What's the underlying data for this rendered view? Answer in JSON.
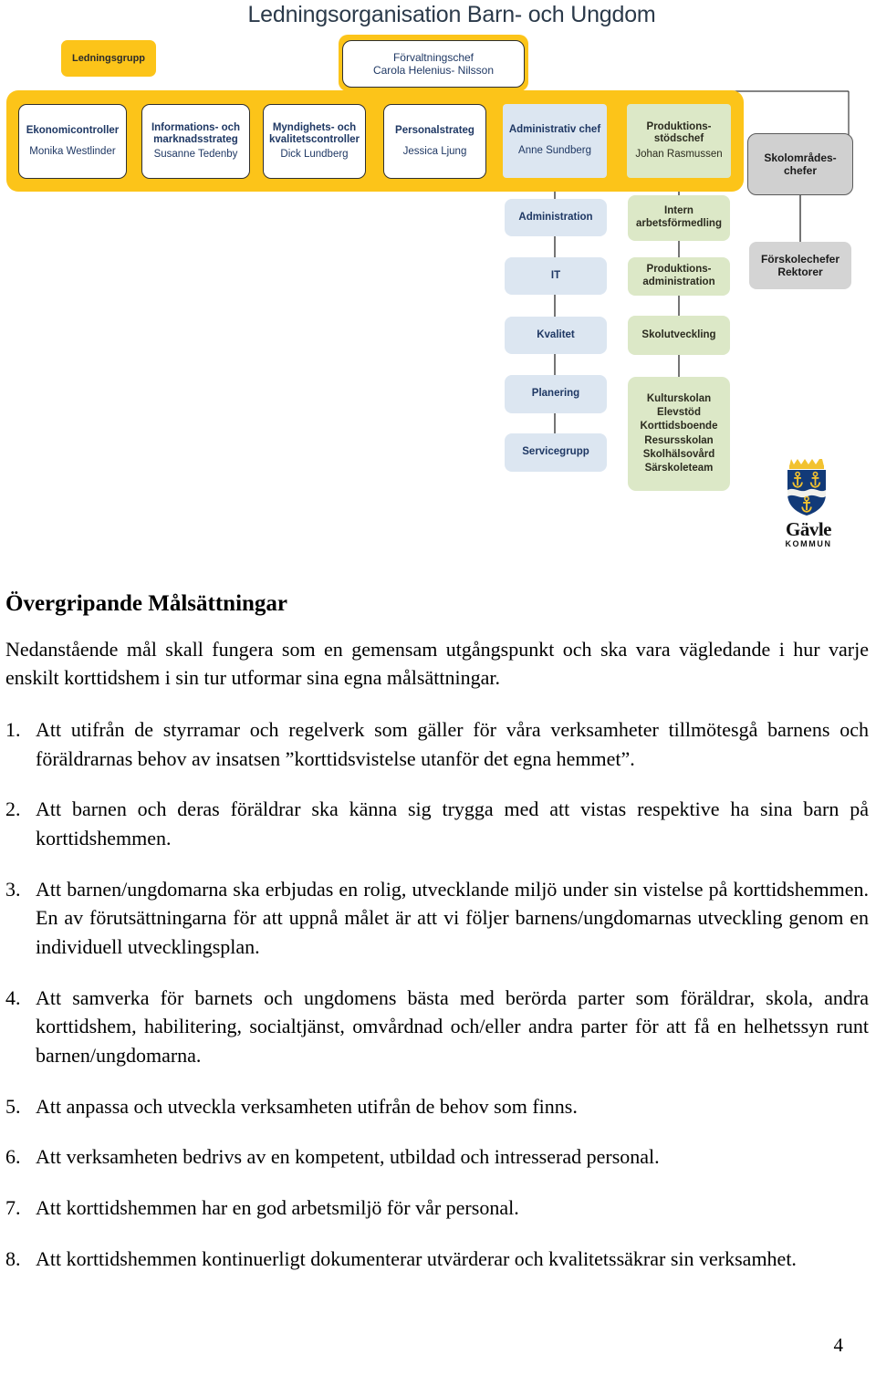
{
  "chart": {
    "title": "Ledningsorganisation Barn- och Ungdom",
    "leadership_group_label": "Ledningsgrupp",
    "director": {
      "title": "Förvaltningschef",
      "name": "Carola Helenius- Nilsson"
    },
    "row": [
      {
        "title": "Ekonomicontroller",
        "name": "Monika Westlinder"
      },
      {
        "title_line1": "Informations- och",
        "title_line2": "marknadsstrateg",
        "name": "Susanne Tedenby"
      },
      {
        "title_line1": "Myndighets- och",
        "title_line2": "kvalitetscontroller",
        "name": "Dick Lundberg"
      },
      {
        "title": "Personalstrateg",
        "name": "Jessica Ljung"
      },
      {
        "title": "Administrativ chef",
        "name": "Anne Sundberg"
      },
      {
        "title_line1": "Produktions-",
        "title_line2": "stödschef",
        "name": "Johan Rasmussen"
      }
    ],
    "school_area": {
      "line1": "Skolområdes-",
      "line2": "chefer"
    },
    "preschool": {
      "line1": "Förskolechefer",
      "line2": "Rektorer"
    },
    "admin_column": [
      "Administration",
      "IT",
      "Kvalitet",
      "Planering",
      "Servicegrupp"
    ],
    "production_column": [
      {
        "line1": "Intern",
        "line2": "arbetsförmedling"
      },
      {
        "line1": "Produktions-",
        "line2": "administration"
      },
      {
        "line1": "Skolutveckling"
      }
    ],
    "production_services": [
      "Kulturskolan",
      "Elevstöd",
      "Korttidsboende",
      "Resursskolan",
      "Skolhälsovård",
      "Särskoleteam"
    ],
    "logo": {
      "wordmark": "Gävle",
      "submark": "KOMMUN"
    },
    "colors": {
      "yellow": "#fcc419",
      "blue_box": "#dce6f1",
      "green_box": "#dce8c7",
      "gray_box": "#d0d0d0",
      "title_text": "#2b3a4a",
      "box_text_blue": "#1f3864"
    }
  },
  "document": {
    "heading": "Övergripande Målsättningar",
    "intro": "Nedanstående mål skall fungera som en gemensam utgångspunkt och ska vara vägledande i hur varje enskilt korttidshem i sin tur utformar sina egna målsättningar.",
    "goals": [
      {
        "num": "1.",
        "text": "Att utifrån de styrramar och regelverk som gäller för våra verksamheter tillmötesgå barnens och föräldrarnas behov av insatsen ”korttidsvistelse utanför det egna hemmet”."
      },
      {
        "num": "2.",
        "text": "Att barnen och deras föräldrar ska känna sig trygga med att vistas respektive ha sina barn på korttidshemmen."
      },
      {
        "num": "3.",
        "text": "Att barnen/ungdomarna ska erbjudas en rolig, utvecklande miljö under sin vistelse på korttidshemmen. En av förutsättningarna för att uppnå målet är att vi följer barnens/ungdomarnas utveckling genom en individuell utvecklingsplan."
      },
      {
        "num": "4.",
        "text": "Att samverka för barnets och ungdomens bästa med berörda parter som föräldrar, skola, andra korttidshem, habilitering, socialtjänst, omvårdnad och/eller andra parter för att få en helhetssyn runt barnen/ungdomarna."
      },
      {
        "num": "5.",
        "text": "Att anpassa och utveckla verksamheten utifrån de behov som finns."
      },
      {
        "num": "6.",
        "text": "Att verksamheten bedrivs av en kompetent, utbildad och intresserad personal."
      },
      {
        "num": "7.",
        "text": "Att korttidshemmen har en god arbetsmiljö för vår personal."
      },
      {
        "num": "8.",
        "text": "Att korttidshemmen kontinuerligt dokumenterar utvärderar och kvalitetssäkrar sin verksamhet."
      }
    ],
    "page_number": "4"
  }
}
